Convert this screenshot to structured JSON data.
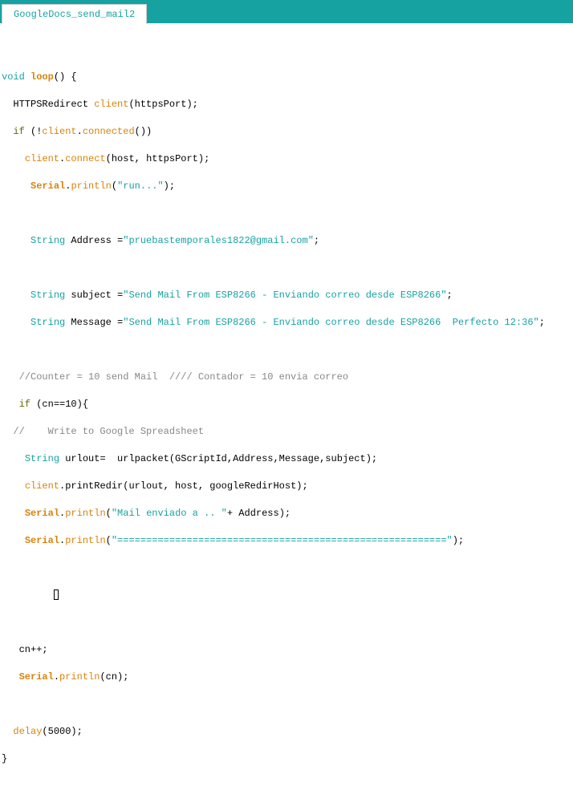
{
  "tab": {
    "title": "GoogleDocs_send_mail2"
  },
  "code": {
    "l0": "",
    "l1_void": "void",
    "l1_loop": "loop",
    "l2_indent": "  HTTPSRedirect ",
    "l2_client": "client",
    "l2_rest": "(httpsPort);",
    "l3_indent": "  ",
    "l3_if": "if",
    "l3_open": " (!",
    "l3_client": "client",
    "l3_dot": ".",
    "l3_connected": "connected",
    "l3_rest": "())",
    "l4_indent": "    ",
    "l4_client": "client",
    "l4_dot": ".",
    "l4_connect": "connect",
    "l4_rest": "(host, httpsPort);",
    "l5_indent": "     ",
    "l5_serial": "Serial",
    "l5_dot": ".",
    "l5_println": "println",
    "l5_open": "(",
    "l5_str": "\"run...\"",
    "l5_close": ");",
    "l6": "",
    "l7_indent": "     ",
    "l7_type": "String",
    "l7_mid": " Address =",
    "l7_str": "\"pruebastemporales1822@gmail.com\"",
    "l7_end": ";",
    "l8": "",
    "l9_indent": "     ",
    "l9_type": "String",
    "l9_mid": " subject =",
    "l9_str": "\"Send Mail From ESP8266 - Enviando correo desde ESP8266\"",
    "l9_end": ";",
    "l10_indent": "     ",
    "l10_type": "String",
    "l10_mid": " Message =",
    "l10_str": "\"Send Mail From ESP8266 - Enviando correo desde ESP8266  Perfecto 12:36\"",
    "l10_end": ";",
    "l11": "",
    "l12_comment": "   //Counter = 10 send Mail  //// Contador = 10 envia correo",
    "l13_indent": "   ",
    "l13_if": "if",
    "l13_rest": " (cn==10){",
    "l14_comment": "  //    Write to Google Spreadsheet",
    "l15_indent": "    ",
    "l15_type": "String",
    "l15_rest": " urlout=  urlpacket(GScriptId,Address,Message,subject);",
    "l16_indent": "    ",
    "l16_client": "client",
    "l16_rest": ".printRedir(urlout, host, googleRedirHost);",
    "l17_indent": "    ",
    "l17_serial": "Serial",
    "l17_dot": ".",
    "l17_println": "println",
    "l17_open": "(",
    "l17_str": "\"Mail enviado a .. \"",
    "l17_rest": "+ Address);",
    "l18_indent": "    ",
    "l18_serial": "Serial",
    "l18_dot": ".",
    "l18_println": "println",
    "l18_open": "(",
    "l18_str": "\"=========================================================\"",
    "l18_close": ");",
    "l19": "",
    "l20_indent": "         ",
    "l21": "",
    "l22_rest": "   cn++;",
    "l23_indent": "   ",
    "l23_serial": "Serial",
    "l23_dot": ".",
    "l23_println": "println",
    "l23_rest": "(cn);",
    "l24": "",
    "l25_indent": "  ",
    "l25_delay": "delay",
    "l25_rest": "(5000);",
    "l26_rest": "}"
  }
}
